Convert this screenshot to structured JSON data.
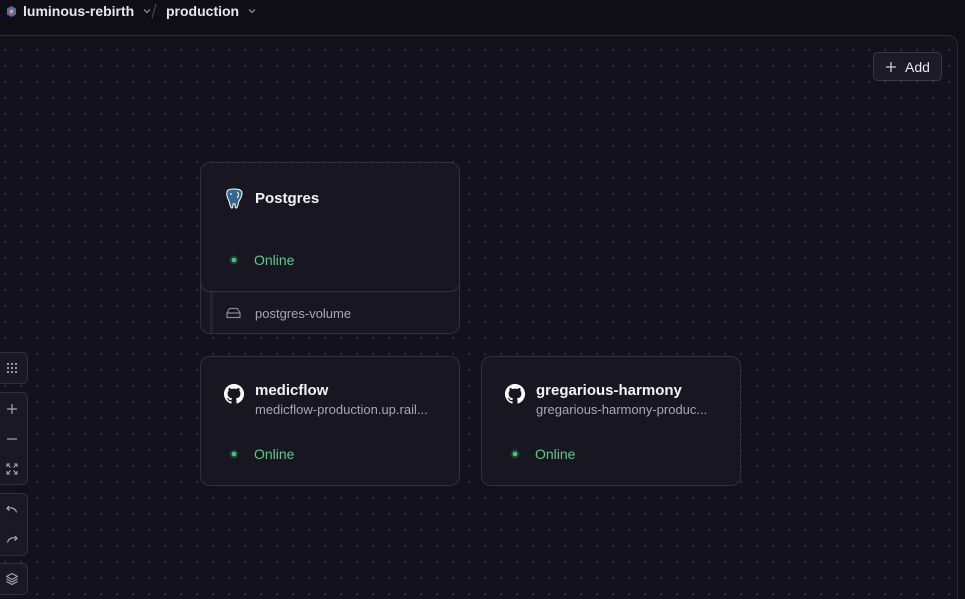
{
  "breadcrumb": {
    "project": "luminous-rebirth",
    "environment": "production"
  },
  "toolbar": {
    "add_label": "Add"
  },
  "services": [
    {
      "name": "Postgres",
      "icon": "postgres-elephant-icon",
      "url": "",
      "status": "Online",
      "volume": "postgres-volume"
    },
    {
      "name": "medicflow",
      "icon": "github-icon",
      "url": "medicflow-production.up.rail...",
      "status": "Online"
    },
    {
      "name": "gregarious-harmony",
      "icon": "github-icon",
      "url": "gregarious-harmony-produc...",
      "status": "Online"
    }
  ],
  "canvas_controls": [
    "grid-icon",
    "zoom-in-icon",
    "zoom-out-icon",
    "fit-view-icon",
    "undo-icon",
    "redo-icon",
    "layers-icon"
  ],
  "colors": {
    "background": "#13111b",
    "card": "#181621",
    "border": "#33303c",
    "status_online": "#5fc98a"
  }
}
